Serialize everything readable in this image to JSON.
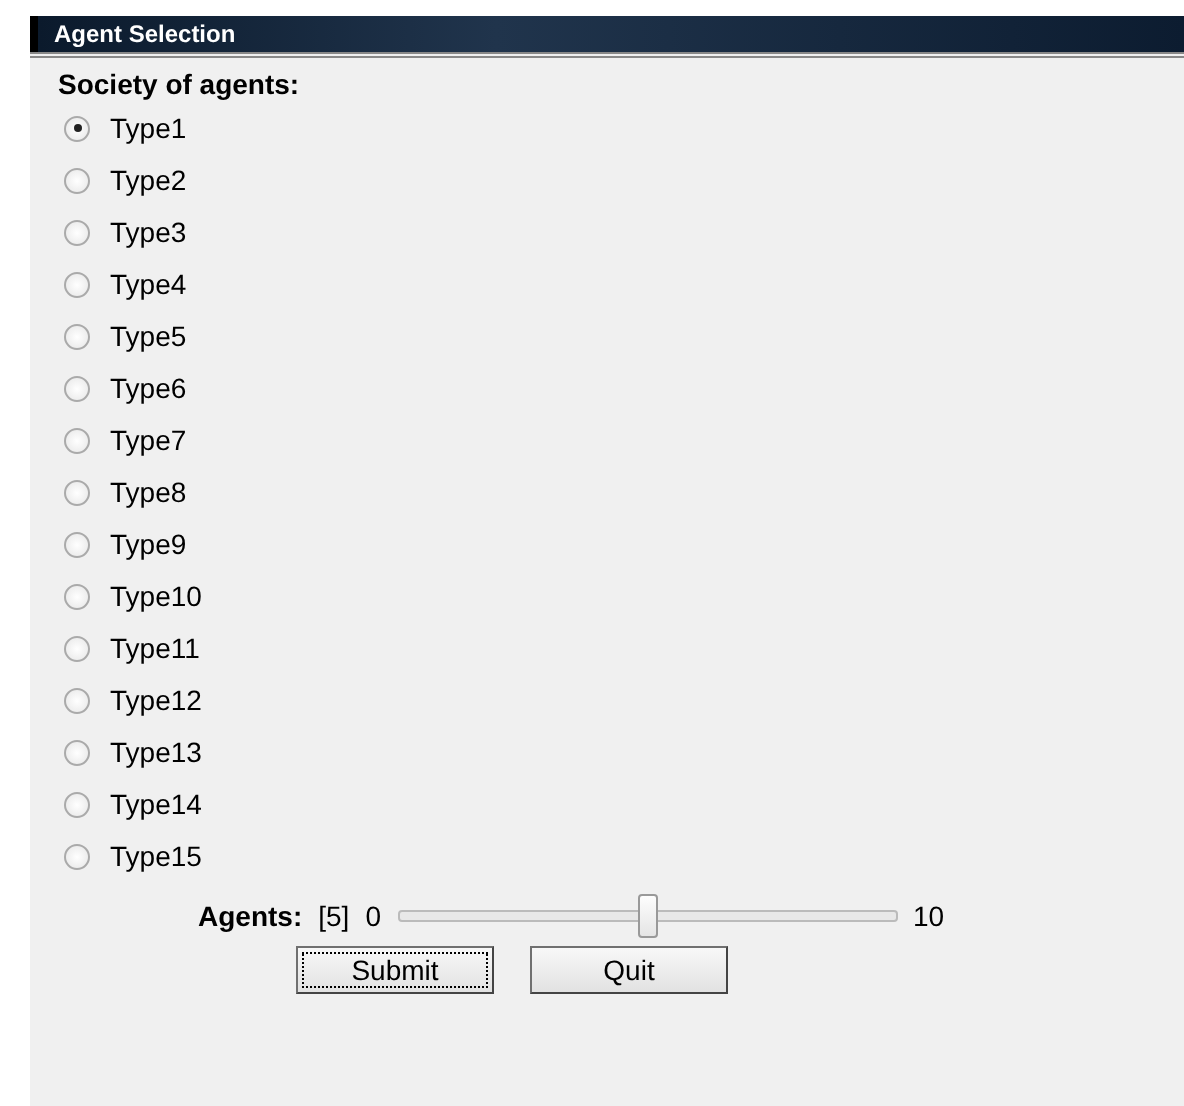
{
  "window": {
    "title": "Agent Selection"
  },
  "heading": "Society of agents:",
  "options": [
    {
      "label": "Type1",
      "selected": true
    },
    {
      "label": "Type2",
      "selected": false
    },
    {
      "label": "Type3",
      "selected": false
    },
    {
      "label": "Type4",
      "selected": false
    },
    {
      "label": "Type5",
      "selected": false
    },
    {
      "label": "Type6",
      "selected": false
    },
    {
      "label": "Type7",
      "selected": false
    },
    {
      "label": "Type8",
      "selected": false
    },
    {
      "label": "Type9",
      "selected": false
    },
    {
      "label": "Type10",
      "selected": false
    },
    {
      "label": "Type11",
      "selected": false
    },
    {
      "label": "Type12",
      "selected": false
    },
    {
      "label": "Type13",
      "selected": false
    },
    {
      "label": "Type14",
      "selected": false
    },
    {
      "label": "Type15",
      "selected": false
    }
  ],
  "slider": {
    "label": "Agents:",
    "reading": "[5]",
    "min": "0",
    "max": "10",
    "level": 0.5
  },
  "buttons": [
    {
      "label": "Submit",
      "focused": true
    },
    {
      "label": "Quit",
      "focused": false
    }
  ]
}
